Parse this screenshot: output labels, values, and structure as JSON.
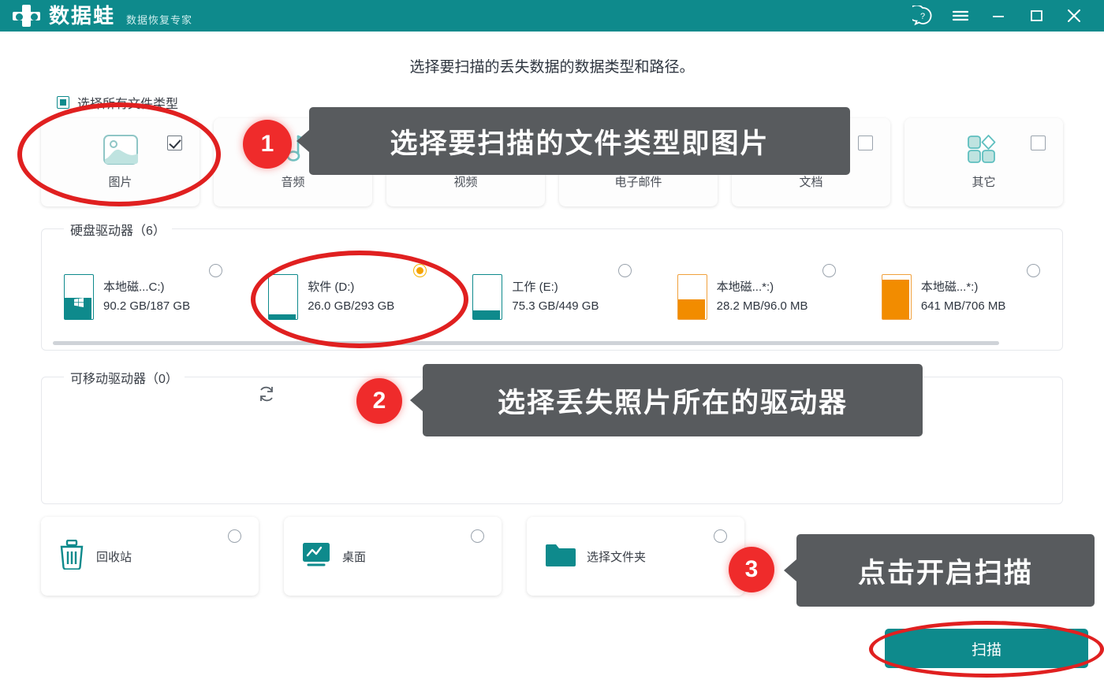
{
  "titlebar": {
    "brand": "数据蛙",
    "subtitle": "数据恢复专家",
    "controls": [
      {
        "name": "help-icon",
        "label": "?"
      },
      {
        "name": "menu-icon",
        "label": "≡"
      },
      {
        "name": "minimize-icon",
        "label": "–"
      },
      {
        "name": "maximize-icon",
        "label": "□"
      },
      {
        "name": "close-icon",
        "label": "✕"
      }
    ]
  },
  "main": {
    "heading": "选择要扫描的丢失数据的数据类型和路径。",
    "select_all_label": "选择所有文件类型",
    "file_types": [
      {
        "label": "图片",
        "icon": "image-icon",
        "checked": true
      },
      {
        "label": "音频",
        "icon": "audio-icon",
        "checked": false
      },
      {
        "label": "视频",
        "icon": "video-icon",
        "checked": false
      },
      {
        "label": "电子邮件",
        "icon": "email-icon",
        "checked": false
      },
      {
        "label": "文档",
        "icon": "document-icon",
        "checked": false
      },
      {
        "label": "其它",
        "icon": "other-icon",
        "checked": false
      }
    ],
    "hard_drives": {
      "title": "硬盘驱动器（6）",
      "items": [
        {
          "name": "本地磁...C:)",
          "capacity": "90.2 GB/187 GB",
          "selected": false,
          "color": "teal",
          "fill_pct": 52,
          "system": true
        },
        {
          "name": "软件 (D:)",
          "capacity": "26.0 GB/293 GB",
          "selected": true,
          "color": "teal",
          "fill_pct": 9,
          "system": false
        },
        {
          "name": "工作 (E:)",
          "capacity": "75.3 GB/449 GB",
          "selected": false,
          "color": "teal",
          "fill_pct": 17,
          "system": false
        },
        {
          "name": "本地磁...*:)",
          "capacity": "28.2 MB/96.0 MB",
          "selected": false,
          "color": "orange",
          "fill_pct": 45,
          "system": false
        },
        {
          "name": "本地磁...*:)",
          "capacity": "641 MB/706 MB",
          "selected": false,
          "color": "orange",
          "fill_pct": 91,
          "system": false
        }
      ]
    },
    "removable_drives": {
      "title": "可移动驱动器（0）",
      "refresh_icon": "refresh-icon"
    },
    "shortcuts": [
      {
        "label": "回收站",
        "icon": "trash-icon",
        "selected": false
      },
      {
        "label": "桌面",
        "icon": "desktop-icon",
        "selected": false
      },
      {
        "label": "选择文件夹",
        "icon": "folder-icon",
        "selected": false
      }
    ],
    "scan_button": "扫描"
  },
  "annotations": {
    "badges": [
      "1",
      "2",
      "3"
    ],
    "callouts": [
      "选择要扫描的文件类型即图片",
      "选择丢失照片所在的驱动器",
      "点击开启扫描"
    ]
  },
  "colors": {
    "brand_teal": "#0e8a8c",
    "accent_orange": "#f28c00",
    "annotation_red": "#e02020",
    "callout_gray": "#585b5e"
  }
}
